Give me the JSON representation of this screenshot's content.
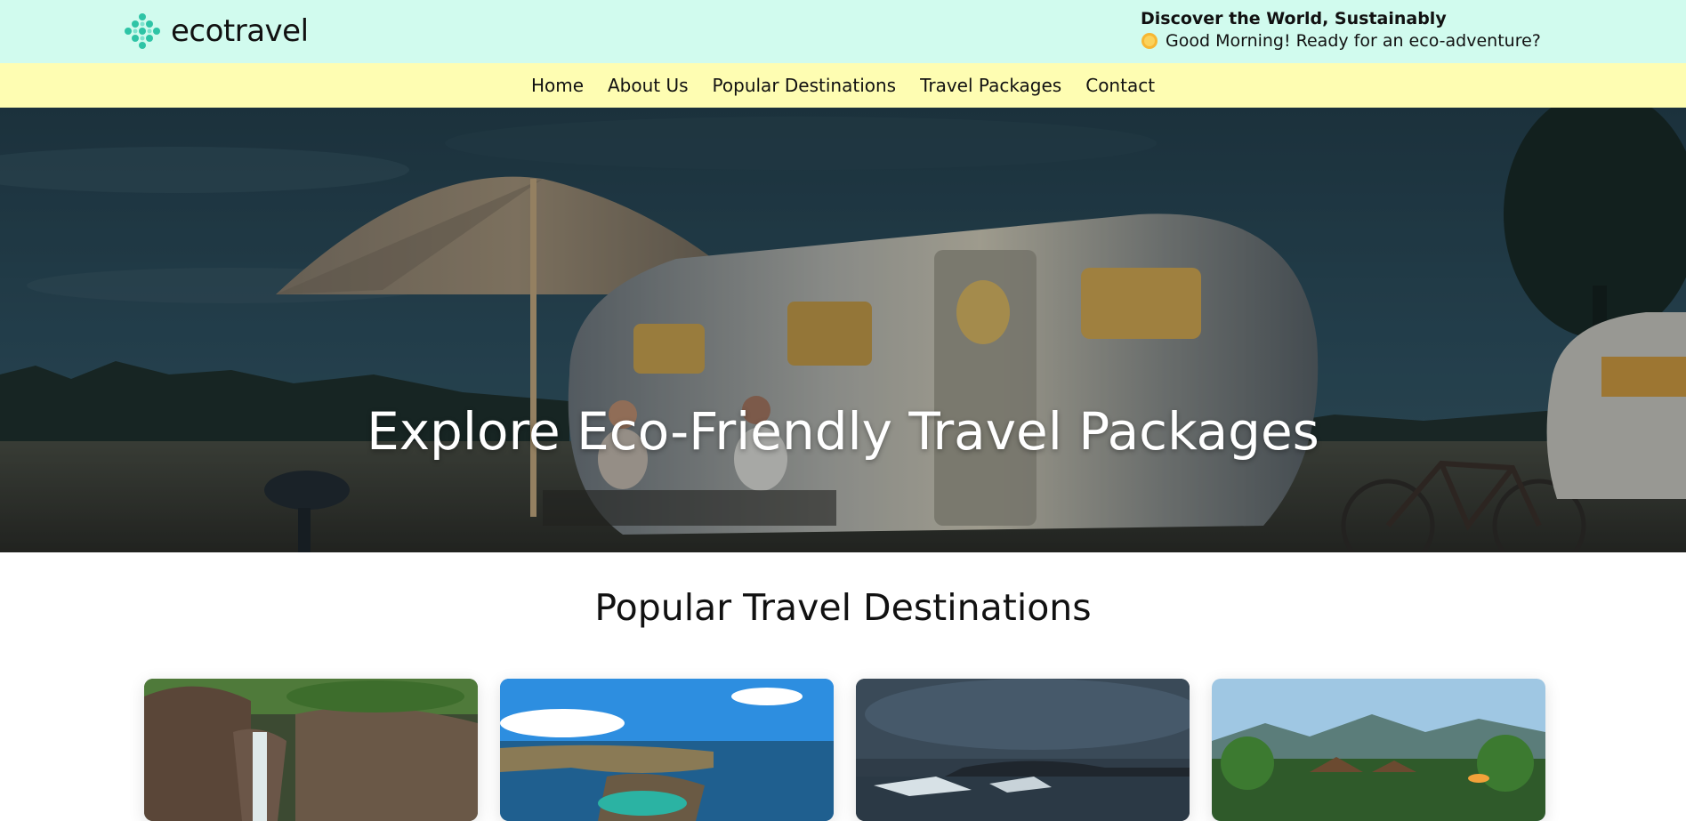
{
  "header": {
    "brand": "ecotravel",
    "tagline_title": "Discover the World, Sustainably",
    "tagline_greeting": "Good Morning! Ready for an eco-adventure?"
  },
  "nav": {
    "items": [
      "Home",
      "About Us",
      "Popular Destinations",
      "Travel Packages",
      "Contact"
    ]
  },
  "hero": {
    "title": "Explore Eco-Friendly Travel Packages"
  },
  "destinations": {
    "title": "Popular Travel Destinations",
    "cards": [
      {
        "image": "waterfall-canyon-photo"
      },
      {
        "image": "rocky-coastline-photo"
      },
      {
        "image": "glacier-lagoon-photo"
      },
      {
        "image": "tropical-resort-photo"
      }
    ]
  },
  "colors": {
    "header_bg": "#d1fbee",
    "nav_bg": "#fefdb2",
    "logo_teal": "#2ec4a6"
  }
}
